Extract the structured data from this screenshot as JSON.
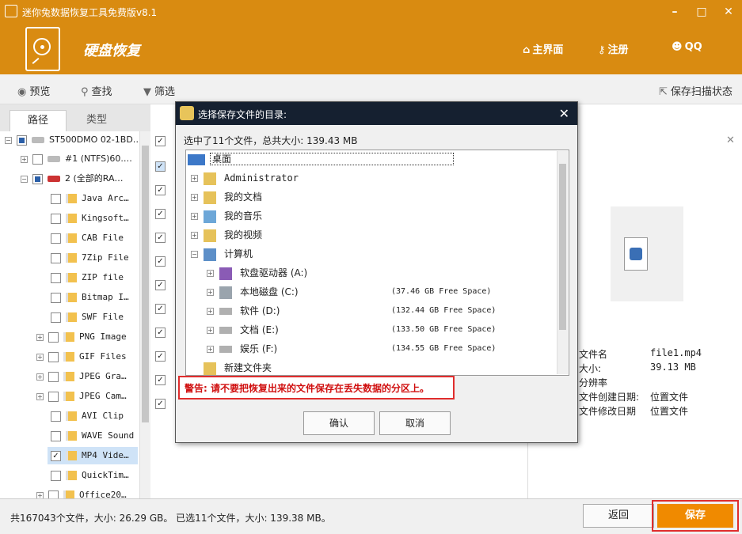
{
  "window": {
    "title": "迷你兔数据恢复工具免费版v8.1"
  },
  "header": {
    "app_title": "硬盘恢复",
    "nav": [
      {
        "label": "主界面"
      },
      {
        "label": "注册"
      },
      {
        "label": "QQ"
      }
    ]
  },
  "toolbar": {
    "preview": "预览",
    "search": "查找",
    "filter": "筛选",
    "save_scan": "保存扫描状态"
  },
  "tabs": [
    {
      "label": "路径"
    },
    {
      "label": "类型"
    }
  ],
  "tree": [
    {
      "label": "ST500DMO 02-1BD…"
    },
    {
      "label": "#1 (NTFS)60.…"
    },
    {
      "label": "2 (全部的RA…"
    },
    {
      "label": "Java Arc…"
    },
    {
      "label": "Kingsoft…"
    },
    {
      "label": "CAB File"
    },
    {
      "label": "7Zip File"
    },
    {
      "label": "ZIP file"
    },
    {
      "label": "Bitmap I…"
    },
    {
      "label": "SWF File"
    },
    {
      "label": "PNG Image"
    },
    {
      "label": "GIF Files"
    },
    {
      "label": "JPEG Gra…"
    },
    {
      "label": "JPEG Cam…"
    },
    {
      "label": "AVI Clip"
    },
    {
      "label": "WAVE Sound"
    },
    {
      "label": "MP4 Vide…"
    },
    {
      "label": "QuickTim…"
    },
    {
      "label": "Office20…"
    }
  ],
  "properties": [
    {
      "key": "文件名",
      "value": "file1.mp4"
    },
    {
      "key": "大小:",
      "value": "39.13 MB"
    },
    {
      "key": "分辨率",
      "value": ""
    },
    {
      "key": "文件创建日期:",
      "value": "位置文件"
    },
    {
      "key": "文件修改日期",
      "value": "位置文件"
    }
  ],
  "status": {
    "text": "共167043个文件，大小: 26.29 GB。 已选11个文件，大小: 139.38 MB。",
    "back": "返回",
    "save": "保存"
  },
  "dialog": {
    "title": "选择保存文件的目录:",
    "info": "选中了11个文件，总共大小: 139.43 MB",
    "tree": [
      {
        "label": "桌面"
      },
      {
        "label": "Administrator"
      },
      {
        "label": "我的文档"
      },
      {
        "label": "我的音乐"
      },
      {
        "label": "我的视频"
      },
      {
        "label": "计算机"
      },
      {
        "label": "软盘驱动器 (A:)",
        "free": ""
      },
      {
        "label": "本地磁盘 (C:)",
        "free": "(37.46 GB Free Space)"
      },
      {
        "label": "软件 (D:)",
        "free": "(132.44 GB Free Space)"
      },
      {
        "label": "文档 (E:)",
        "free": "(133.50 GB Free Space)"
      },
      {
        "label": "娱乐 (F:)",
        "free": "(134.55 GB Free Space)"
      },
      {
        "label": "新建文件夹"
      }
    ],
    "warning": "警告: 请不要把恢复出来的文件保存在丢失数据的分区上。",
    "ok": "确认",
    "cancel": "取消"
  },
  "colors": {
    "brand": "#d98b11",
    "save": "#f08a00",
    "warning": "#d01010"
  }
}
